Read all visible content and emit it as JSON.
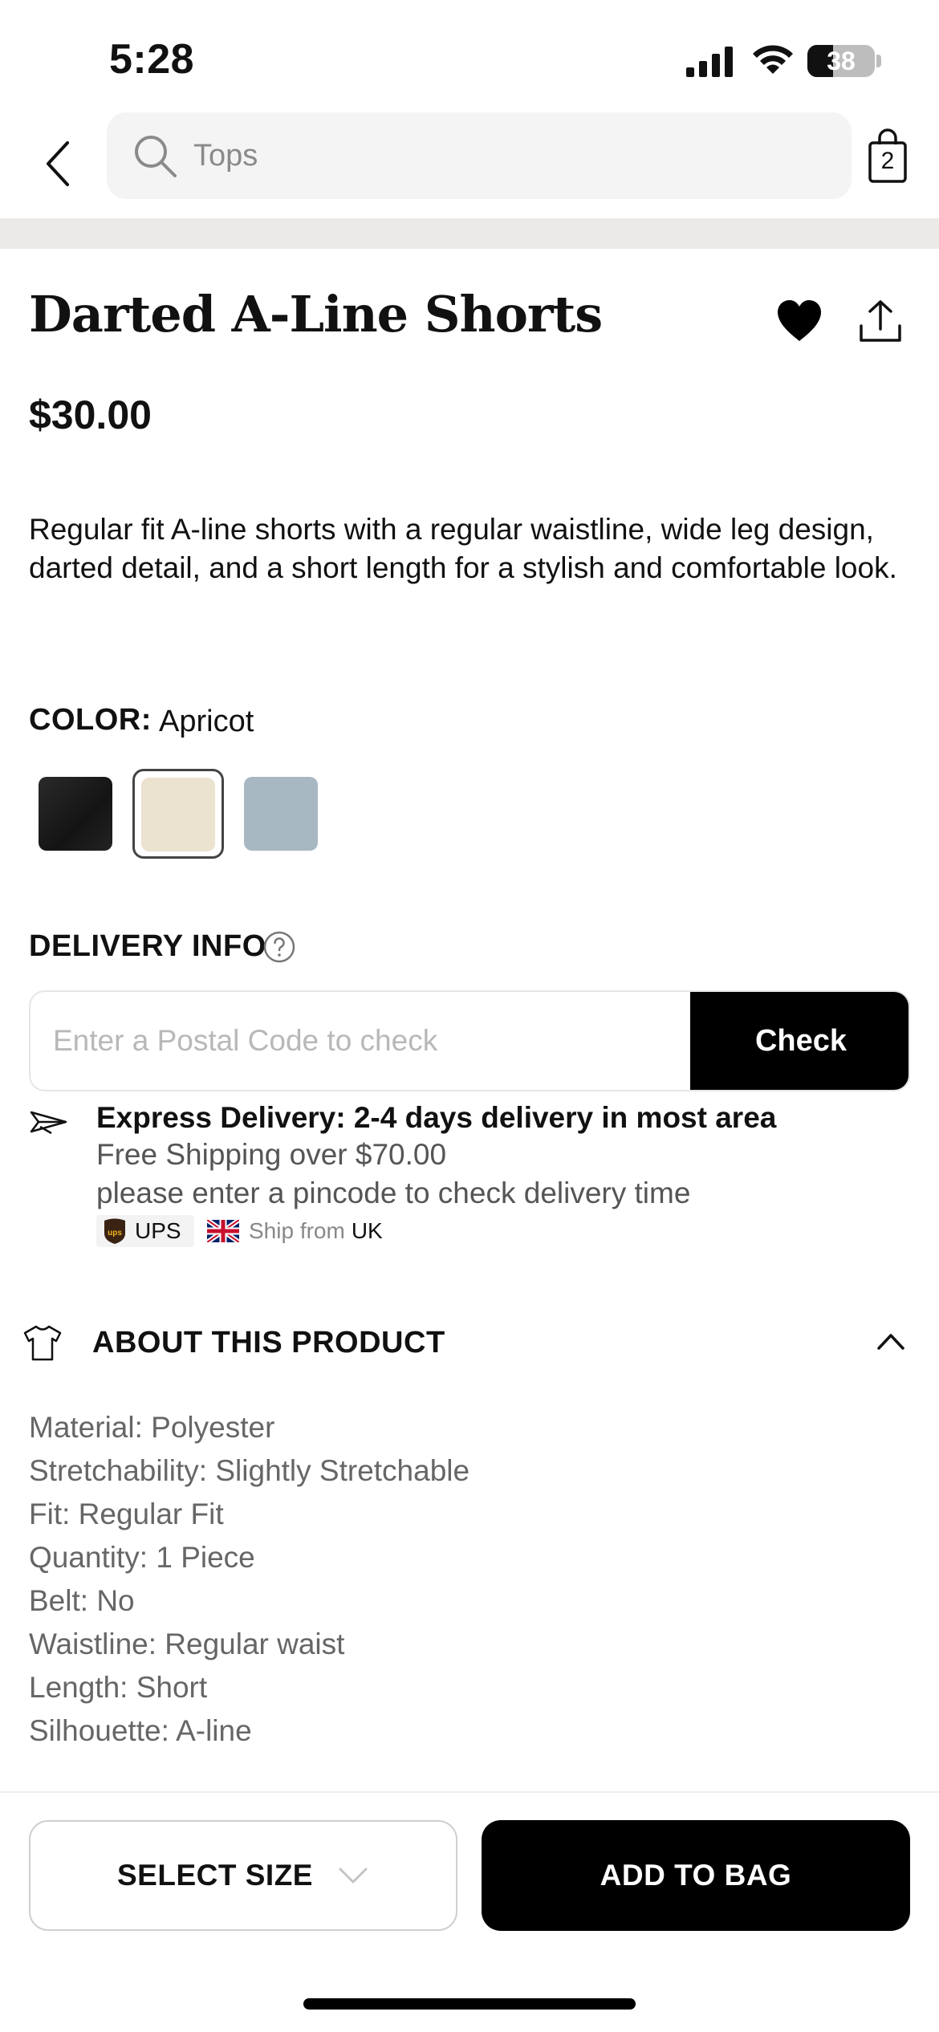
{
  "status_bar": {
    "time": "5:28",
    "battery": "38",
    "battery_level": 0.38
  },
  "nav": {
    "search_placeholder": "Tops",
    "bag_count": "2"
  },
  "product": {
    "title": "Darted A-Line Shorts",
    "price": "$30.00",
    "description": "Regular fit A-line shorts with a regular waistline, wide leg design, darted detail, and a short length for a stylish and comfortable look.",
    "favorited": true
  },
  "color": {
    "label": "COLOR:",
    "selected": "Apricot",
    "swatches": [
      {
        "name": "black",
        "hex": "#1b1b1b"
      },
      {
        "name": "apricot",
        "hex": "#ece2d0",
        "selected": true
      },
      {
        "name": "blue-gray",
        "hex": "#a8b8c2"
      }
    ]
  },
  "delivery": {
    "label": "DELIVERY INFO",
    "postal_placeholder": "Enter a Postal Code to check",
    "check_label": "Check",
    "express_title": "Express Delivery: 2-4 days delivery in most area",
    "free_shipping": "Free Shipping over $70.00",
    "pincode_note": "please enter a pincode to check delivery time",
    "carrier": "UPS",
    "ship_from_label": "Ship from",
    "ship_from_country": "UK"
  },
  "about": {
    "title": "ABOUT THIS PRODUCT",
    "attributes": [
      "Material: Polyester",
      "Stretchability: Slightly Stretchable",
      "Fit: Regular Fit",
      "Quantity: 1 Piece",
      "Belt: No",
      "Waistline: Regular waist",
      "Length: Short",
      "Silhouette: A-line"
    ]
  },
  "actions": {
    "select_size": "SELECT SIZE",
    "add_to_bag": "ADD TO BAG"
  },
  "colors": {
    "accent": "#000000",
    "muted_text": "#666666",
    "brand_ups": "#3a2312"
  }
}
